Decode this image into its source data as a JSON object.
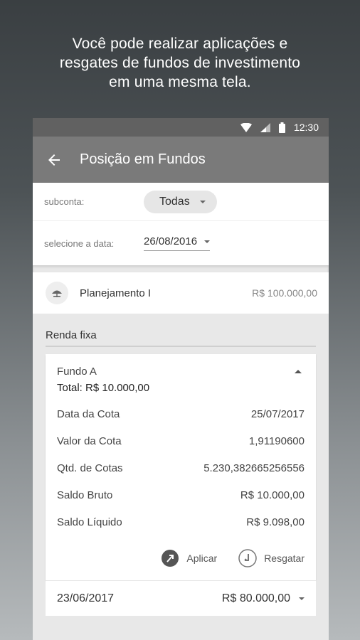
{
  "headline": {
    "line1": "Você pode realizar aplicações e",
    "line2": "resgates de fundos de investimento",
    "line3": "em uma mesma tela."
  },
  "status_bar": {
    "time": "12:30",
    "icons": [
      "wifi-icon",
      "signal-icon",
      "battery-icon"
    ]
  },
  "app_bar": {
    "title": "Posição em Fundos",
    "back_icon": "arrow-left-icon"
  },
  "filters": {
    "subconta_label": "subconta:",
    "subconta_value": "Todas",
    "date_label": "selecione a data:",
    "date_value": "26/08/2016"
  },
  "plan": {
    "name": "Planejamento I",
    "value": "R$ 100.000,00",
    "icon": "umbrella-icon"
  },
  "section_title": "Renda fixa",
  "fund": {
    "name": "Fundo A",
    "total": "Total: R$ 10.000,00",
    "details": [
      {
        "label": "Data da Cota",
        "value": "25/07/2017"
      },
      {
        "label": "Valor da Cota",
        "value": "1,91190600"
      },
      {
        "label": "Qtd. de Cotas",
        "value": "5.230,382665256556"
      },
      {
        "label": "Saldo Bruto",
        "value": "R$ 10.000,00"
      },
      {
        "label": "Saldo Líquido",
        "value": "R$ 9.098,00"
      }
    ],
    "actions": {
      "apply_label": "Aplicar",
      "redeem_label": "Resgatar"
    }
  },
  "history": {
    "date": "23/06/2017",
    "value": "R$ 80.000,00"
  },
  "colors": {
    "appbar": "#7a7a7a",
    "statusbar": "#616161"
  }
}
